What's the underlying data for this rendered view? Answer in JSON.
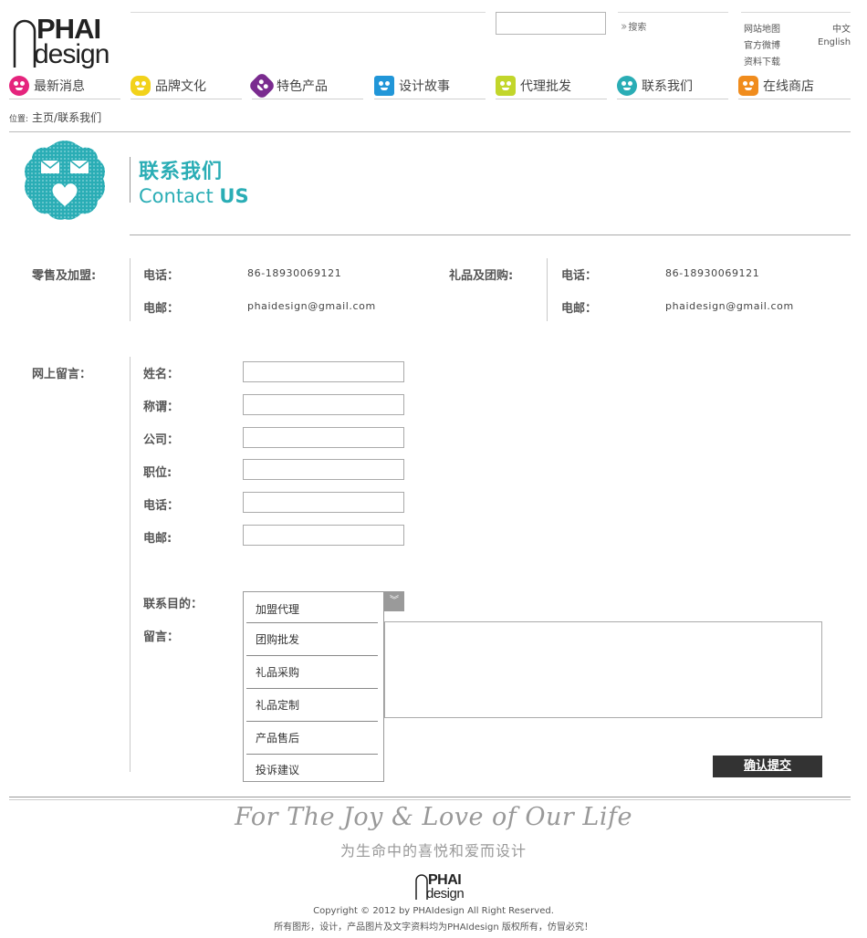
{
  "header": {
    "logo_text": "PHAI design",
    "search": {
      "placeholder": "",
      "button_label": "搜索"
    },
    "links": {
      "sitemap": "网站地图",
      "weibo": "官方微博",
      "download": "资料下载",
      "lang_cn": "中文",
      "lang_en": "English"
    }
  },
  "nav": {
    "items": [
      {
        "label": "最新消息",
        "icon": "pink-face-icon",
        "color": "#e5247d"
      },
      {
        "label": "品牌文化",
        "icon": "yellow-flower-face-icon",
        "color": "#f2d21a"
      },
      {
        "label": "特色产品",
        "icon": "purple-star-face-icon",
        "color": "#7a2b8f"
      },
      {
        "label": "设计故事",
        "icon": "blue-square-icon",
        "color": "#2196d8"
      },
      {
        "label": "代理批发",
        "icon": "lime-face-icon",
        "color": "#c2d62b"
      },
      {
        "label": "联系我们",
        "icon": "teal-face-icon",
        "color": "#2aadb5"
      },
      {
        "label": "在线商店",
        "icon": "orange-face-icon",
        "color": "#f08c1d"
      }
    ]
  },
  "breadcrumb": {
    "prefix": "位置:",
    "path": "主页/联系我们"
  },
  "contact_header": {
    "title_cn": "联系我们",
    "title_en_1": "Contact ",
    "title_en_2": "US",
    "accent": "#2aadb5"
  },
  "info": {
    "retail": {
      "heading": "零售及加盟:",
      "phone_label": "电话：",
      "phone": "86-18930069121",
      "email_label": "电邮：",
      "email": "phaidesign@gmail.com"
    },
    "gift": {
      "heading": "礼品及团购:",
      "phone_label": "电话：",
      "phone": "86-18930069121",
      "email_label": "电邮：",
      "email": "phaidesign@gmail.com"
    }
  },
  "form": {
    "heading": "网上留言：",
    "fields": {
      "name": "姓名：",
      "title": "称谓：",
      "company": "公司：",
      "position": "职位:",
      "phone": "电话：",
      "email": "电邮:"
    },
    "purpose_label": "联系目的：",
    "message_label": "留言：",
    "purpose_options": [
      "加盟代理",
      "团购批发",
      "礼品采购",
      "礼品定制",
      "产品售后",
      "投诉建议"
    ],
    "submit_label": "确认提交"
  },
  "footer": {
    "tagline_en": "For The Joy & Love of Our Life",
    "tagline_cn": "为生命中的喜悦和爱而设计",
    "copyright": "Copyright © 2012 by PHAIdesign All Right Reserved.",
    "rights": "所有图形，设计，产品图片及文字资料均为PHAIdesign  版权所有，仿冒必究！"
  }
}
